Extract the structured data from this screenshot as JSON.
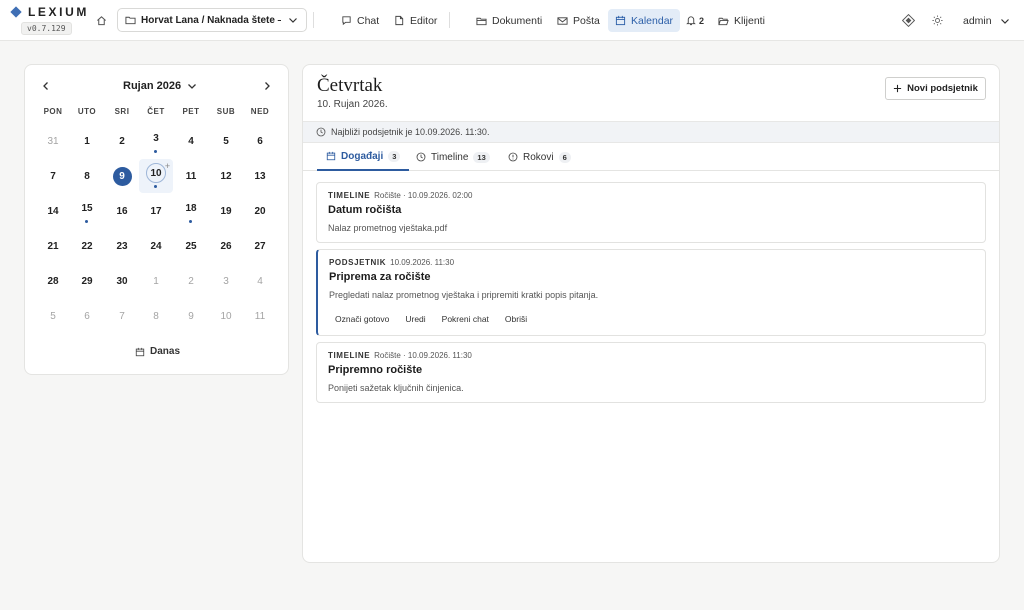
{
  "app": {
    "name": "LEXIUM",
    "version": "v0.7.129"
  },
  "header": {
    "case_selector": "Horvat Lana / Naknada štete — …",
    "nav": [
      {
        "id": "chat",
        "label": "Chat",
        "icon": "chat-icon"
      },
      {
        "id": "editor",
        "label": "Editor",
        "icon": "edit-icon"
      },
      {
        "id": "dokumenti",
        "label": "Dokumenti",
        "icon": "folder-icon"
      },
      {
        "id": "posta",
        "label": "Pošta",
        "icon": "mail-icon"
      },
      {
        "id": "kalendar",
        "label": "Kalendar",
        "icon": "calendar-icon",
        "active": true
      },
      {
        "id": "notifications",
        "label": "2",
        "icon": "bell-icon"
      },
      {
        "id": "klijenti",
        "label": "Klijenti",
        "icon": "folder-open-icon"
      }
    ],
    "user": "admin"
  },
  "calendar": {
    "month_label": "Rujan 2026",
    "weekdays": [
      "PON",
      "UTO",
      "SRI",
      "ČET",
      "PET",
      "SUB",
      "NED"
    ],
    "weeks": [
      [
        "31",
        "1",
        "2",
        "3",
        "4",
        "5",
        "6"
      ],
      [
        "7",
        "8",
        "9",
        "10",
        "11",
        "12",
        "13"
      ],
      [
        "14",
        "15",
        "16",
        "17",
        "18",
        "19",
        "20"
      ],
      [
        "21",
        "22",
        "23",
        "24",
        "25",
        "26",
        "27"
      ],
      [
        "28",
        "29",
        "30",
        "1",
        "2",
        "3",
        "4"
      ],
      [
        "5",
        "6",
        "7",
        "8",
        "9",
        "10",
        "11"
      ]
    ],
    "today_button": "Danas"
  },
  "detail": {
    "weekday": "Četvrtak",
    "date": "10. Rujan 2026.",
    "new_reminder_button": "Novi podsjetnik",
    "notice": "Najbliži podsjetnik je 10.09.2026. 11:30.",
    "tabs": [
      {
        "label": "Događaji",
        "count": "3",
        "active": true
      },
      {
        "label": "Timeline",
        "count": "13"
      },
      {
        "label": "Rokovi",
        "count": "6"
      }
    ],
    "events": [
      {
        "type": "TIMELINE",
        "meta": "Ročište · 10.09.2026. 02:00",
        "title": "Datum ročišta",
        "desc": "Nalaz prometnog vještaka.pdf"
      },
      {
        "type": "PODSJETNIK",
        "meta": "10.09.2026. 11:30",
        "title": "Priprema za ročište",
        "desc": "Pregledati nalaz prometnog vještaka i pripremiti kratki popis pitanja.",
        "actions": [
          "Označi gotovo",
          "Uredi",
          "Pokreni chat",
          "Obriši"
        ]
      },
      {
        "type": "TIMELINE",
        "meta": "Ročište · 10.09.2026. 11:30",
        "title": "Pripremno ročište",
        "desc": "Ponijeti sažetak ključnih činjenica."
      }
    ]
  },
  "colors": {
    "accent": "#2d5b9f",
    "active_nav_bg": "#e3ecf7"
  }
}
